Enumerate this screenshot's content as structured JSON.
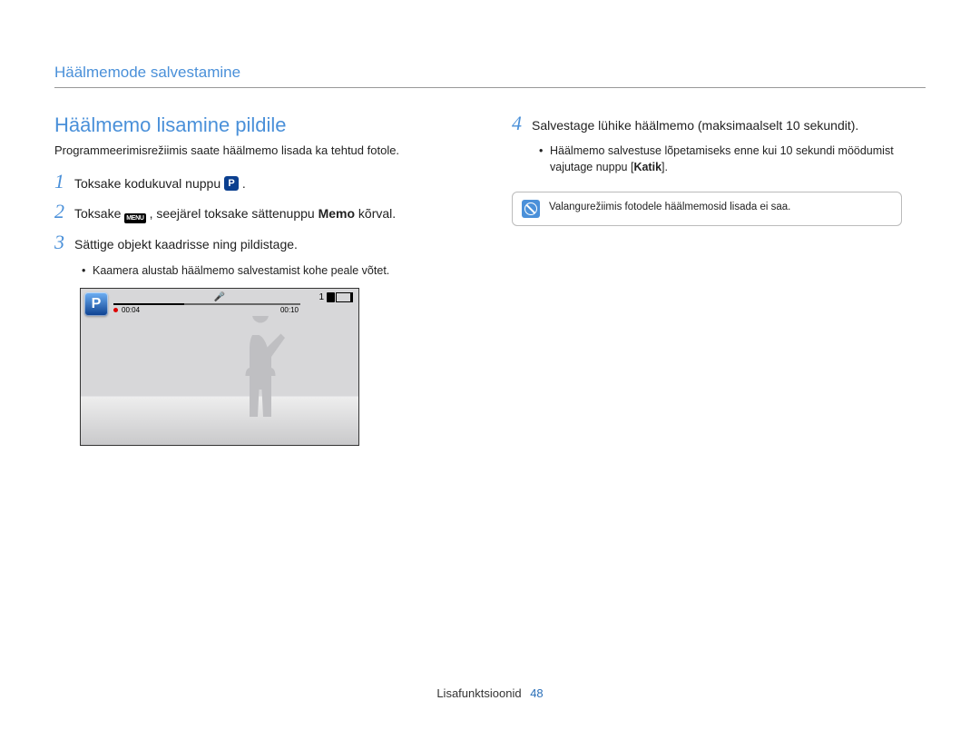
{
  "header": "Häälmemode salvestamine",
  "title": "Häälmemo lisamine pildile",
  "intro": "Programmeerimisrežiimis saate häälmemo lisada ka tehtud fotole.",
  "steps": {
    "s1": {
      "num": "1",
      "pre": "Toksake kodukuval nuppu ",
      "post": "."
    },
    "s2": {
      "num": "2",
      "pre": "Toksake ",
      "mid": ", seejärel toksake sättenuppu ",
      "bold": "Memo",
      "post": " kõrval."
    },
    "s3": {
      "num": "3",
      "body": "Sättige objekt kaadrisse ning pildistage."
    },
    "s3_sub": "Kaamera alustab häälmemo salvestamist kohe peale võtet.",
    "s4": {
      "num": "4",
      "body": "Salvestage lühike häälmemo (maksimaalselt 10 sekundit)."
    },
    "s4_sub_pre": "Häälmemo salvestuse lõpetamiseks enne kui 10 sekundi möödumist vajutage nuppu [",
    "s4_sub_bold": "Katik",
    "s4_sub_post": "]."
  },
  "icons": {
    "menu_label": "MENU"
  },
  "screenshot": {
    "time_left": "00:04",
    "time_right": "00:10",
    "shots": "1"
  },
  "note": "Valangurežiimis fotodele häälmemosid lisada ei saa.",
  "footer": {
    "section": "Lisafunktsioonid",
    "page": "48"
  }
}
